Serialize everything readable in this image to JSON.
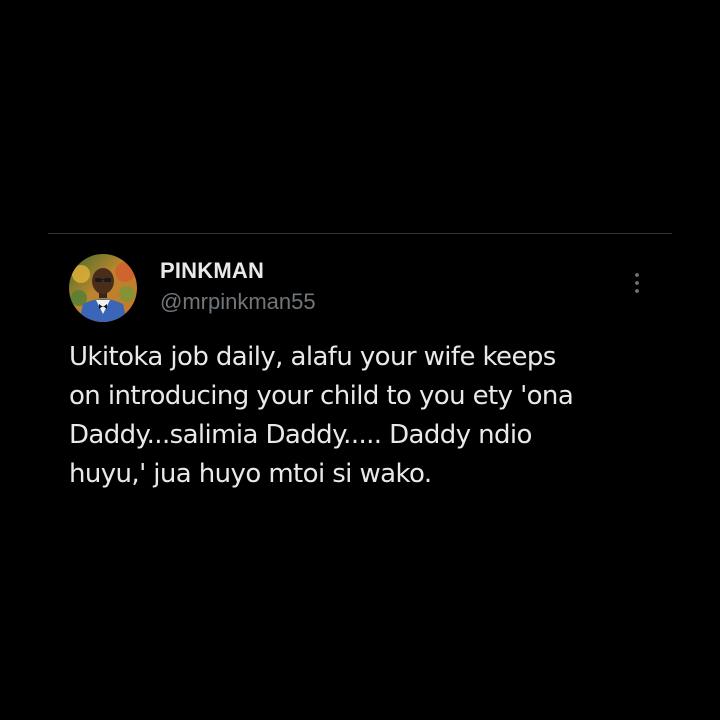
{
  "tweet": {
    "display_name": "PINKMAN",
    "handle": "@mrpinkman55",
    "text_lines": [
      "Ukitoka job daily, alafu your wife keeps",
      "on introducing your child to you ety 'ona",
      "Daddy...salimia Daddy..... Daddy ndio",
      "huyu,' jua huyo mtoi si wako."
    ]
  },
  "icons": {
    "more": "more-vertical-icon",
    "avatar": "profile-photo"
  },
  "colors": {
    "background": "#000000",
    "primary_text": "#e7e9ea",
    "secondary_text": "#71767b",
    "divider": "#2f3336"
  }
}
